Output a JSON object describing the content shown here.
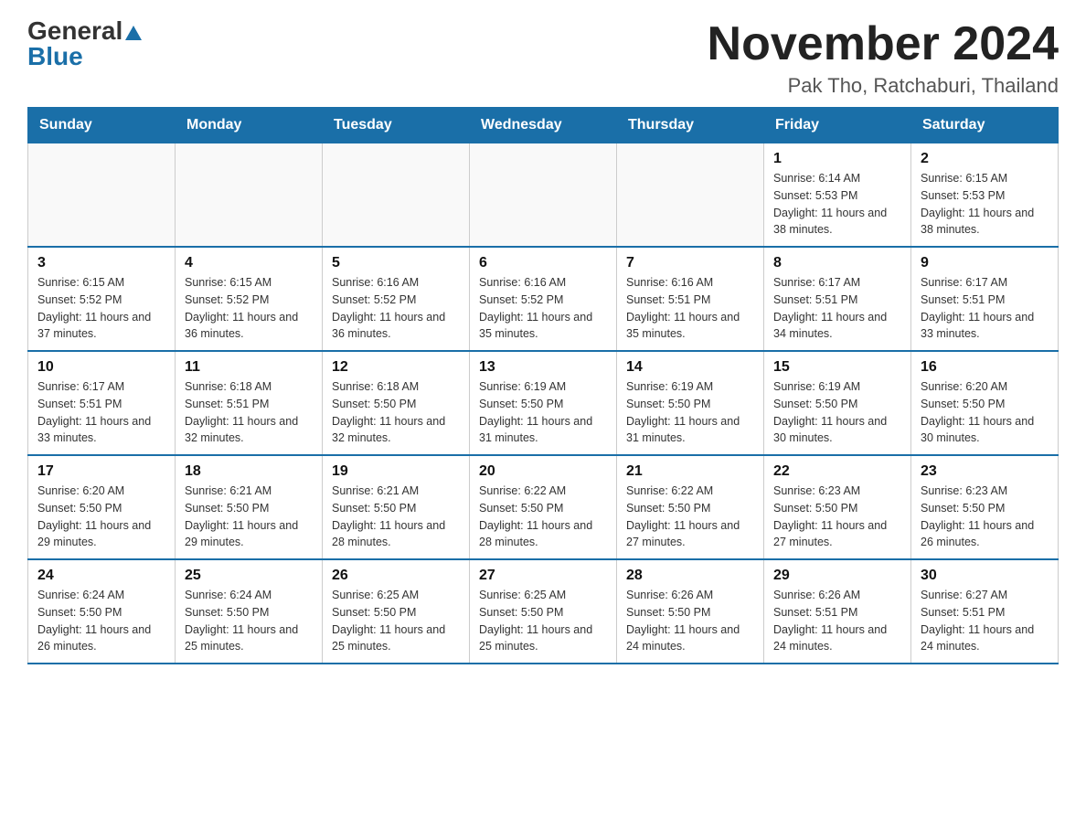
{
  "logo": {
    "general": "General",
    "blue": "Blue"
  },
  "title": "November 2024",
  "location": "Pak Tho, Ratchaburi, Thailand",
  "weekdays": [
    "Sunday",
    "Monday",
    "Tuesday",
    "Wednesday",
    "Thursday",
    "Friday",
    "Saturday"
  ],
  "weeks": [
    [
      {
        "day": "",
        "info": ""
      },
      {
        "day": "",
        "info": ""
      },
      {
        "day": "",
        "info": ""
      },
      {
        "day": "",
        "info": ""
      },
      {
        "day": "",
        "info": ""
      },
      {
        "day": "1",
        "info": "Sunrise: 6:14 AM\nSunset: 5:53 PM\nDaylight: 11 hours and 38 minutes."
      },
      {
        "day": "2",
        "info": "Sunrise: 6:15 AM\nSunset: 5:53 PM\nDaylight: 11 hours and 38 minutes."
      }
    ],
    [
      {
        "day": "3",
        "info": "Sunrise: 6:15 AM\nSunset: 5:52 PM\nDaylight: 11 hours and 37 minutes."
      },
      {
        "day": "4",
        "info": "Sunrise: 6:15 AM\nSunset: 5:52 PM\nDaylight: 11 hours and 36 minutes."
      },
      {
        "day": "5",
        "info": "Sunrise: 6:16 AM\nSunset: 5:52 PM\nDaylight: 11 hours and 36 minutes."
      },
      {
        "day": "6",
        "info": "Sunrise: 6:16 AM\nSunset: 5:52 PM\nDaylight: 11 hours and 35 minutes."
      },
      {
        "day": "7",
        "info": "Sunrise: 6:16 AM\nSunset: 5:51 PM\nDaylight: 11 hours and 35 minutes."
      },
      {
        "day": "8",
        "info": "Sunrise: 6:17 AM\nSunset: 5:51 PM\nDaylight: 11 hours and 34 minutes."
      },
      {
        "day": "9",
        "info": "Sunrise: 6:17 AM\nSunset: 5:51 PM\nDaylight: 11 hours and 33 minutes."
      }
    ],
    [
      {
        "day": "10",
        "info": "Sunrise: 6:17 AM\nSunset: 5:51 PM\nDaylight: 11 hours and 33 minutes."
      },
      {
        "day": "11",
        "info": "Sunrise: 6:18 AM\nSunset: 5:51 PM\nDaylight: 11 hours and 32 minutes."
      },
      {
        "day": "12",
        "info": "Sunrise: 6:18 AM\nSunset: 5:50 PM\nDaylight: 11 hours and 32 minutes."
      },
      {
        "day": "13",
        "info": "Sunrise: 6:19 AM\nSunset: 5:50 PM\nDaylight: 11 hours and 31 minutes."
      },
      {
        "day": "14",
        "info": "Sunrise: 6:19 AM\nSunset: 5:50 PM\nDaylight: 11 hours and 31 minutes."
      },
      {
        "day": "15",
        "info": "Sunrise: 6:19 AM\nSunset: 5:50 PM\nDaylight: 11 hours and 30 minutes."
      },
      {
        "day": "16",
        "info": "Sunrise: 6:20 AM\nSunset: 5:50 PM\nDaylight: 11 hours and 30 minutes."
      }
    ],
    [
      {
        "day": "17",
        "info": "Sunrise: 6:20 AM\nSunset: 5:50 PM\nDaylight: 11 hours and 29 minutes."
      },
      {
        "day": "18",
        "info": "Sunrise: 6:21 AM\nSunset: 5:50 PM\nDaylight: 11 hours and 29 minutes."
      },
      {
        "day": "19",
        "info": "Sunrise: 6:21 AM\nSunset: 5:50 PM\nDaylight: 11 hours and 28 minutes."
      },
      {
        "day": "20",
        "info": "Sunrise: 6:22 AM\nSunset: 5:50 PM\nDaylight: 11 hours and 28 minutes."
      },
      {
        "day": "21",
        "info": "Sunrise: 6:22 AM\nSunset: 5:50 PM\nDaylight: 11 hours and 27 minutes."
      },
      {
        "day": "22",
        "info": "Sunrise: 6:23 AM\nSunset: 5:50 PM\nDaylight: 11 hours and 27 minutes."
      },
      {
        "day": "23",
        "info": "Sunrise: 6:23 AM\nSunset: 5:50 PM\nDaylight: 11 hours and 26 minutes."
      }
    ],
    [
      {
        "day": "24",
        "info": "Sunrise: 6:24 AM\nSunset: 5:50 PM\nDaylight: 11 hours and 26 minutes."
      },
      {
        "day": "25",
        "info": "Sunrise: 6:24 AM\nSunset: 5:50 PM\nDaylight: 11 hours and 25 minutes."
      },
      {
        "day": "26",
        "info": "Sunrise: 6:25 AM\nSunset: 5:50 PM\nDaylight: 11 hours and 25 minutes."
      },
      {
        "day": "27",
        "info": "Sunrise: 6:25 AM\nSunset: 5:50 PM\nDaylight: 11 hours and 25 minutes."
      },
      {
        "day": "28",
        "info": "Sunrise: 6:26 AM\nSunset: 5:50 PM\nDaylight: 11 hours and 24 minutes."
      },
      {
        "day": "29",
        "info": "Sunrise: 6:26 AM\nSunset: 5:51 PM\nDaylight: 11 hours and 24 minutes."
      },
      {
        "day": "30",
        "info": "Sunrise: 6:27 AM\nSunset: 5:51 PM\nDaylight: 11 hours and 24 minutes."
      }
    ]
  ]
}
